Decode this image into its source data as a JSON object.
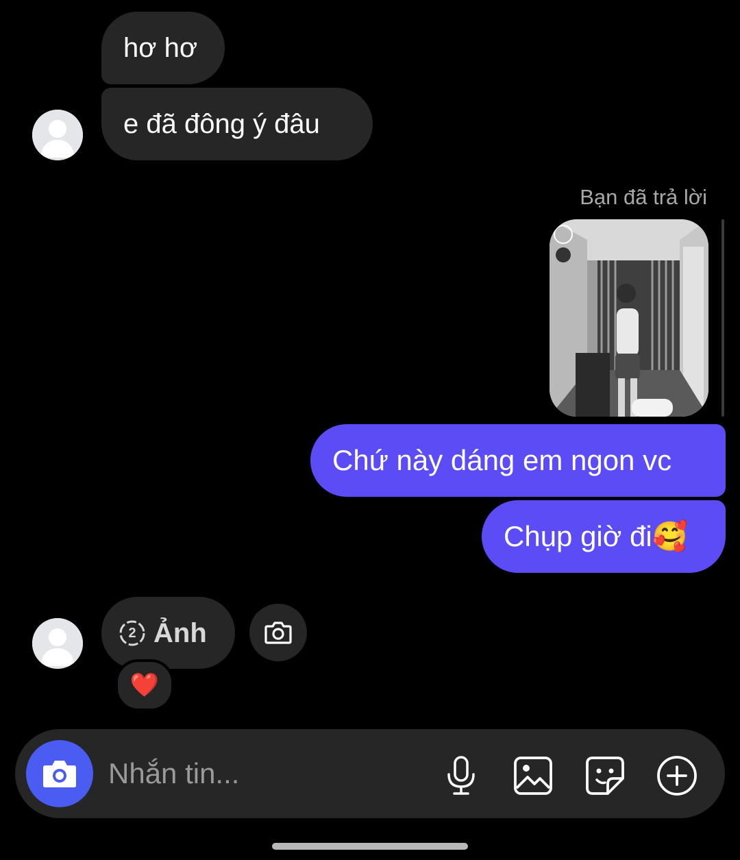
{
  "messages": {
    "incoming_1": "hơ hơ",
    "incoming_2": "e đã đông ý đâu",
    "reply_label": "Bạn đã trả lời",
    "outgoing_1": "Chứ này dáng em ngon vc",
    "outgoing_2": "Chụp giờ đi🥰",
    "view_once_count": "2",
    "view_once_label": "Ảnh",
    "reaction": "❤️"
  },
  "composer": {
    "placeholder": "Nhắn tin..."
  },
  "colors": {
    "background": "#000000",
    "incoming_bubble": "#262626",
    "outgoing_bubble": "#5b4cf5",
    "camera_button": "#4b5cf2"
  },
  "icons": {
    "avatar": "default-avatar-icon",
    "view_once": "view-once-icon",
    "camera_reply": "camera-icon",
    "camera_compose": "camera-icon",
    "mic": "microphone-icon",
    "gallery": "gallery-icon",
    "sticker": "sticker-icon",
    "plus": "plus-circle-icon"
  }
}
